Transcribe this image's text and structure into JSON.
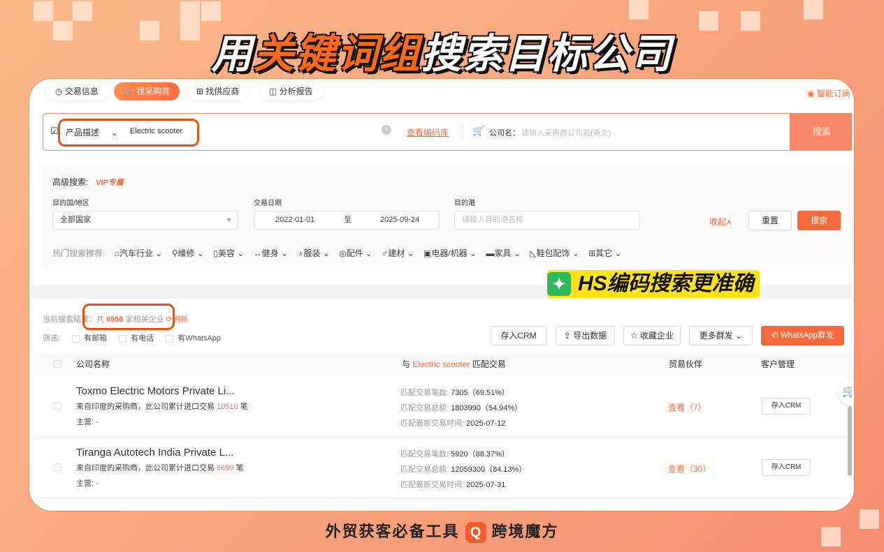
{
  "banner": {
    "title_pre": "用",
    "title_hl": "关键词组",
    "title_post": "搜索目标公司",
    "badge": "HS编码搜索更准确",
    "footer_text": "外贸获客必备工具",
    "brand": "跨境魔方",
    "brand_logo": "Q"
  },
  "tabs": [
    {
      "label": "交易信息"
    },
    {
      "label": "找采购商"
    },
    {
      "label": "找供应商"
    },
    {
      "label": "分析报告"
    }
  ],
  "top_right": "智能订阅",
  "search": {
    "type": "产品描述",
    "value": "Electric scooter",
    "code_link": "查看编码库",
    "company_label": "公司名：",
    "company_placeholder": "请输入采购商公司名(英文)",
    "button": "搜索"
  },
  "advanced": {
    "title": "高级搜索:",
    "vip": "VIP专属",
    "country_label": "目的国/地区",
    "country_value": "全部国家",
    "date_label": "交易日期",
    "date_from": "2022-01-01",
    "date_to_sep": "至",
    "date_to": "2025-09-24",
    "port_label": "目的港",
    "port_placeholder": "请输入目的港名称",
    "collapse": "收起∧",
    "reset": "重置",
    "search": "搜索",
    "hot_label": "热门搜索推荐:",
    "hot": [
      "汽车行业",
      "维修",
      "美容",
      "健身",
      "服装",
      "配件",
      "建材",
      "电器/机器",
      "家具",
      "鞋包配饰",
      "其它"
    ]
  },
  "results": {
    "prefix": "当前搜索结果：共",
    "count": "6956",
    "suffix": "家相关企业",
    "refresh": "刷新",
    "filter_label": "筛选:",
    "filters": [
      "有邮箱",
      "有电话",
      "有WhatsApp"
    ],
    "actions": {
      "crm": "存入CRM",
      "export": "导出数据",
      "fav": "收藏企业",
      "more": "更多群发",
      "whatsapp": "WhatsApp群发"
    }
  },
  "table": {
    "col_name": "公司名称",
    "col_match_pre": "与",
    "col_match_kw": "Electric scooter",
    "col_match_post": "匹配交易",
    "col_partner": "贸易伙伴",
    "col_manage": "客户管理",
    "k_count": "匹配交易笔数:",
    "k_total": "匹配交易总额:",
    "k_latest": "匹配最新交易时间:",
    "from_pre": "来自印度的采购商，此公司累计进口交易",
    "from_post": "笔",
    "main_label": "主营: -",
    "rows": [
      {
        "name": "Toxmo Electric Motors Private Li...",
        "imports": "10510",
        "count": "7305（69.51%）",
        "total": "1803990（54.94%）",
        "latest": "2025-07-12",
        "view": "查看（7）",
        "crm": "存入CRM"
      },
      {
        "name": "Tiranga Autotech India Private L...",
        "imports": "6699",
        "count": "5920（88.37%）",
        "total": "12059300（84.13%）",
        "latest": "2025-07-31",
        "view": "查看（30）",
        "crm": "存入CRM"
      }
    ]
  }
}
